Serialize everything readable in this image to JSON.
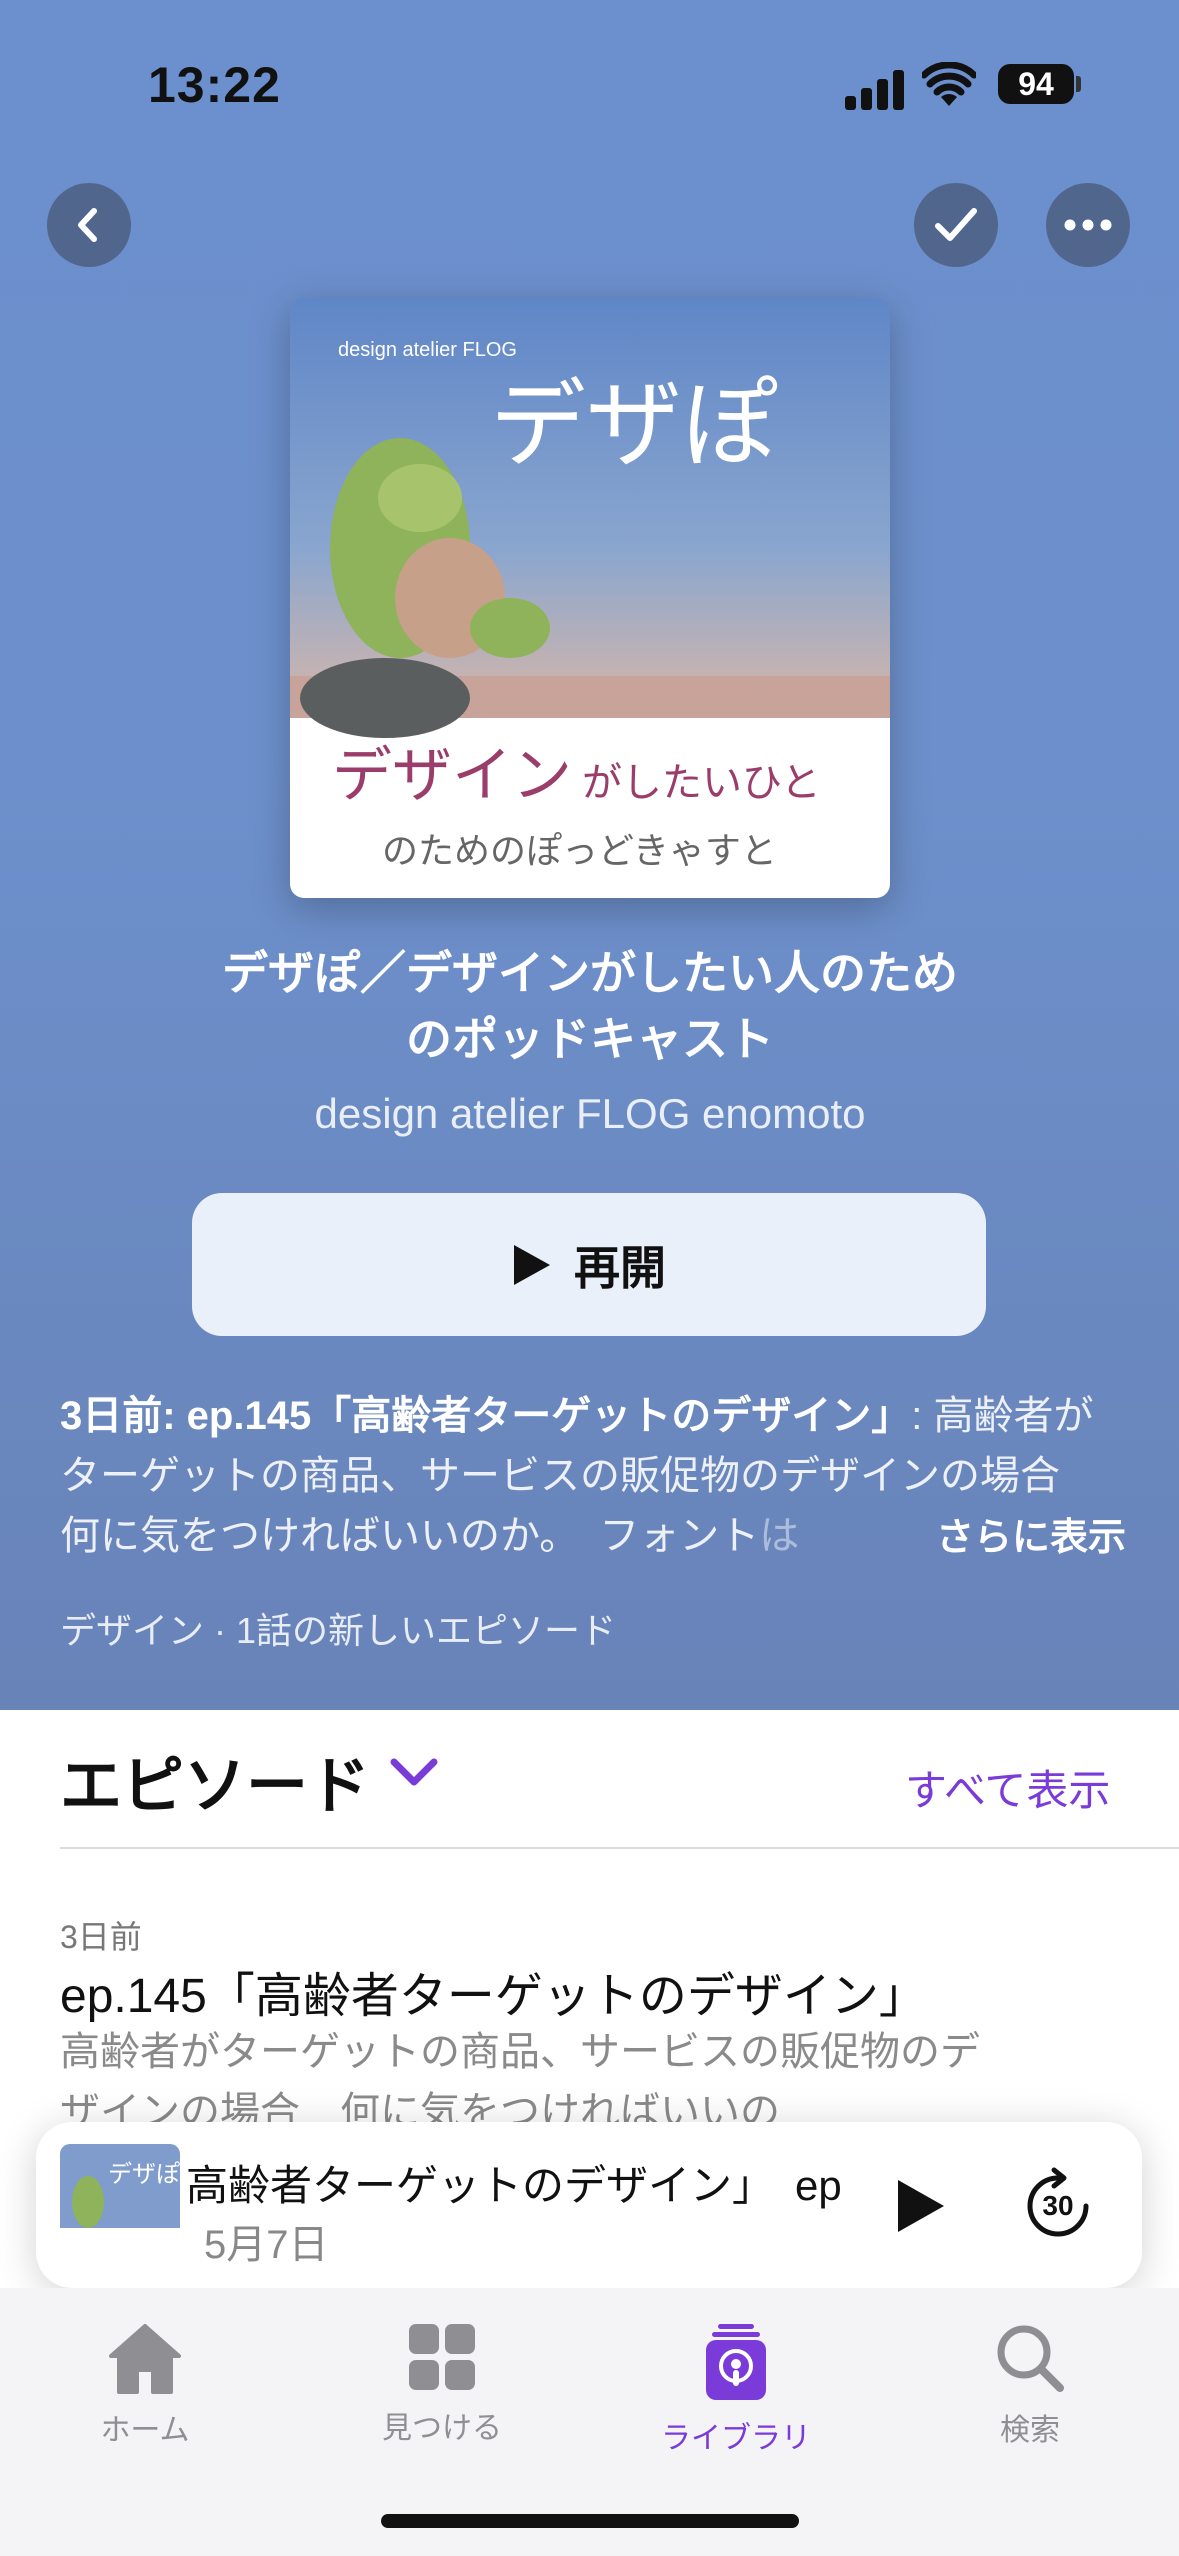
{
  "status": {
    "time": "13:22",
    "battery": "94"
  },
  "podcast": {
    "title_line1": "デザぽ／デザイン​がしたい人のため",
    "title_line2": "のポッドキャスト",
    "author": "design atelier FLOG enomoto",
    "resume_label": "再開",
    "artwork": {
      "brand": "design atelier FLOG",
      "logo_text": "デザぽ",
      "tagline1_big": "デザイン",
      "tagline1_small": "がしたいひと",
      "tagline2": "のためのぽっどきゃすと"
    }
  },
  "latest": {
    "prefix": "3日前: ep.145「高齢者ターゲットのデザイン」",
    "text": ": 高齢者がターゲットの商品、サービスの販促物のデザインの場合　何に気をつければいいのか。　フォント",
    "fade": "は",
    "more_label": "さらに表示",
    "meta": "デザイン · 1話の新しいエピソード"
  },
  "episodes_section": {
    "header": "エピソード",
    "see_all": "すべて表示",
    "items": [
      {
        "date": "3日前",
        "title": "ep.145「高齢者ターゲットのデザイン」",
        "desc": "高齢者がターゲットの商品、サービスの販促物のデザインの場合　何に気をつければいいの"
      }
    ]
  },
  "mini_player": {
    "title": "高齢者ターゲットのデザイン」　ep",
    "date": "5月7日",
    "skip_seconds": "30"
  },
  "tabs": [
    {
      "label": "ホーム",
      "icon": "house-icon"
    },
    {
      "label": "見つける",
      "icon": "grid-icon"
    },
    {
      "label": "ライブラリ",
      "icon": "library-podcast-icon",
      "active": true
    },
    {
      "label": "検索",
      "icon": "magnifier-icon"
    }
  ],
  "colors": {
    "accent": "#7a3bd9",
    "hero": "#6c8fcd"
  }
}
